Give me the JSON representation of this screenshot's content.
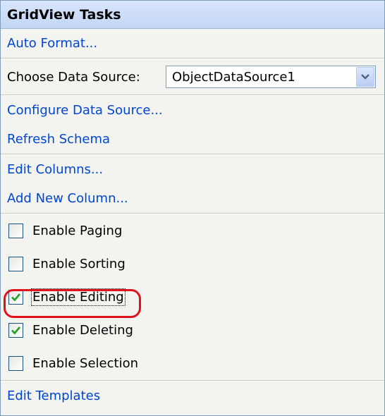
{
  "panel": {
    "title": "GridView Tasks",
    "auto_format": "Auto Format...",
    "choose_data_source_label": "Choose Data Source:",
    "data_source_value": "ObjectDataSource1",
    "configure_data_source": "Configure Data Source...",
    "refresh_schema": "Refresh Schema",
    "edit_columns": "Edit Columns...",
    "add_new_column": "Add New Column...",
    "checkboxes": [
      {
        "label": "Enable Paging",
        "checked": false
      },
      {
        "label": "Enable Sorting",
        "checked": false
      },
      {
        "label": "Enable Editing",
        "checked": true
      },
      {
        "label": "Enable Deleting",
        "checked": true
      },
      {
        "label": "Enable Selection",
        "checked": false
      }
    ],
    "edit_templates": "Edit Templates"
  },
  "colors": {
    "link": "#0046d5",
    "check": "#21a121",
    "highlight": "#e0121b"
  },
  "icons": {
    "dropdown": "chevron-down-icon",
    "check": "checkmark-icon"
  }
}
